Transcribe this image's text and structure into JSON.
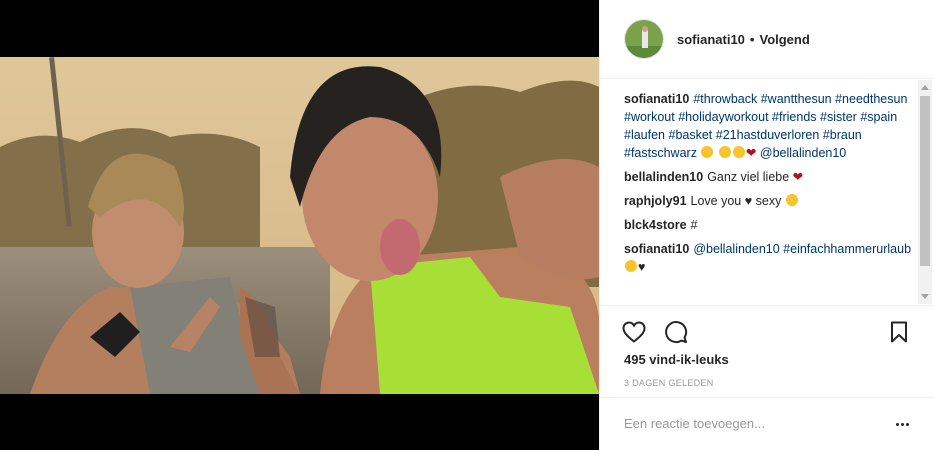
{
  "header": {
    "username": "sofianati10",
    "separator": "•",
    "follow_label": "Volgend"
  },
  "comments": [
    {
      "user": "sofianati10",
      "parts": [
        {
          "t": "tag",
          "v": "#throwback"
        },
        {
          "t": "text",
          "v": " "
        },
        {
          "t": "tag",
          "v": "#wantthesun"
        },
        {
          "t": "text",
          "v": " "
        },
        {
          "t": "tag",
          "v": "#needthesun"
        },
        {
          "t": "text",
          "v": " "
        },
        {
          "t": "tag",
          "v": "#workout"
        },
        {
          "t": "text",
          "v": " "
        },
        {
          "t": "tag",
          "v": "#holidayworkout"
        },
        {
          "t": "text",
          "v": " "
        },
        {
          "t": "tag",
          "v": "#friends"
        },
        {
          "t": "text",
          "v": " "
        },
        {
          "t": "tag",
          "v": "#sister"
        },
        {
          "t": "text",
          "v": " "
        },
        {
          "t": "tag",
          "v": "#spain"
        },
        {
          "t": "text",
          "v": " "
        },
        {
          "t": "tag",
          "v": "#laufen"
        },
        {
          "t": "text",
          "v": " "
        },
        {
          "t": "tag",
          "v": "#basket"
        },
        {
          "t": "text",
          "v": " "
        },
        {
          "t": "tag",
          "v": "#21hastduverloren"
        },
        {
          "t": "text",
          "v": " "
        },
        {
          "t": "tag",
          "v": "#braun"
        },
        {
          "t": "text",
          "v": " "
        },
        {
          "t": "tag",
          "v": "#fastschwarz"
        },
        {
          "t": "text",
          "v": " "
        },
        {
          "t": "emoji",
          "v": "grinning-face-emoji"
        },
        {
          "t": "text",
          "v": " "
        },
        {
          "t": "emoji",
          "v": "winking-face-emoji"
        },
        {
          "t": "emoji",
          "v": "smiling-face-emoji"
        },
        {
          "t": "heart",
          "v": "❤"
        },
        {
          "t": "text",
          "v": " "
        },
        {
          "t": "tag",
          "v": "@bellalinden10"
        }
      ]
    },
    {
      "user": "bellalinden10",
      "parts": [
        {
          "t": "text",
          "v": "Ganz viel liebe "
        },
        {
          "t": "heart",
          "v": "❤"
        }
      ]
    },
    {
      "user": "raphjoly91",
      "parts": [
        {
          "t": "text",
          "v": "Love you "
        },
        {
          "t": "bheart",
          "v": "♥"
        },
        {
          "t": "text",
          "v": " sexy "
        },
        {
          "t": "emoji",
          "v": "heart-eyes-emoji"
        }
      ]
    },
    {
      "user": "blck4store",
      "parts": [
        {
          "t": "text",
          "v": "#"
        }
      ]
    },
    {
      "user": "sofianati10",
      "parts": [
        {
          "t": "tag",
          "v": "@bellalinden10"
        },
        {
          "t": "text",
          "v": " "
        },
        {
          "t": "tag",
          "v": "#einfachhammerurlaub"
        },
        {
          "t": "text",
          "v": " "
        },
        {
          "t": "emoji",
          "v": "heart-eyes-emoji"
        },
        {
          "t": "bheart",
          "v": "♥"
        }
      ]
    }
  ],
  "actions": {
    "likes": "495 vind-ik-leuks",
    "date": "3 DAGEN GELEDEN"
  },
  "add_comment": {
    "placeholder": "Een reactie toevoegen..."
  },
  "icons": {
    "like": "heart-outline-icon",
    "comment": "comment-bubble-icon",
    "save": "bookmark-icon",
    "more": "more-options-icon"
  },
  "colors": {
    "hashtag": "#003569",
    "heart": "#b10e1e",
    "muted": "#999999",
    "text": "#262626"
  }
}
